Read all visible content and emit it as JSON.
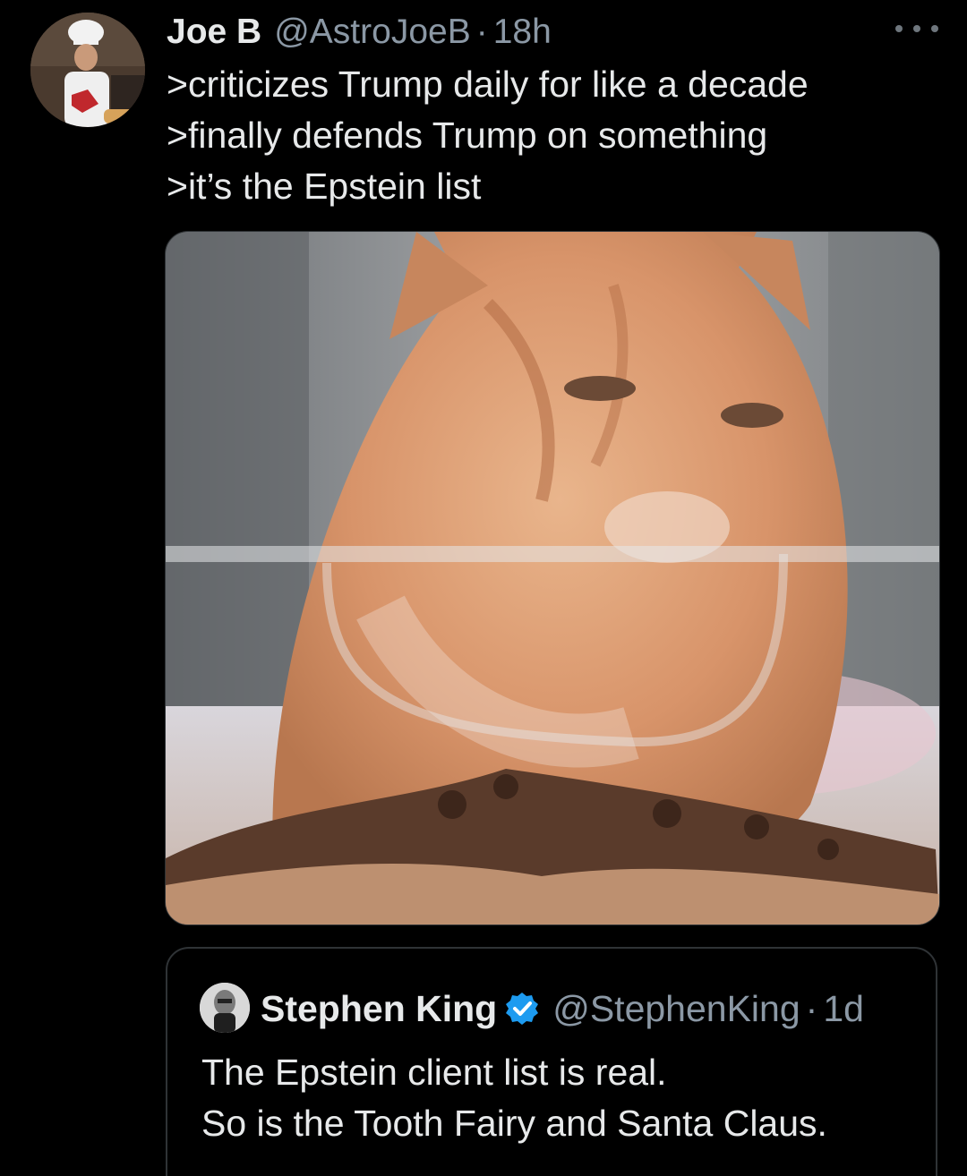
{
  "tweet": {
    "display_name": "Joe B",
    "handle": "@AstroJoeB",
    "separator": "·",
    "time": "18h",
    "lines": [
      ">criticizes Trump daily for like a decade",
      ">finally defends Trump on something",
      ">it’s the Epstein list"
    ]
  },
  "quoted_tweet": {
    "display_name": "Stephen King",
    "handle": "@StephenKing",
    "separator": "·",
    "time": "1d",
    "lines": [
      "The Epstein client list is real.",
      "So is the Tooth Fairy and Santa Claus."
    ]
  },
  "icons": {
    "more": "more-horizontal-icon",
    "verified": "verified-badge-icon"
  },
  "colors": {
    "background": "#000000",
    "text": "#e7e9ea",
    "secondary_text": "#8b98a5",
    "border": "#2f3336",
    "verified_blue": "#1d9bf0"
  }
}
